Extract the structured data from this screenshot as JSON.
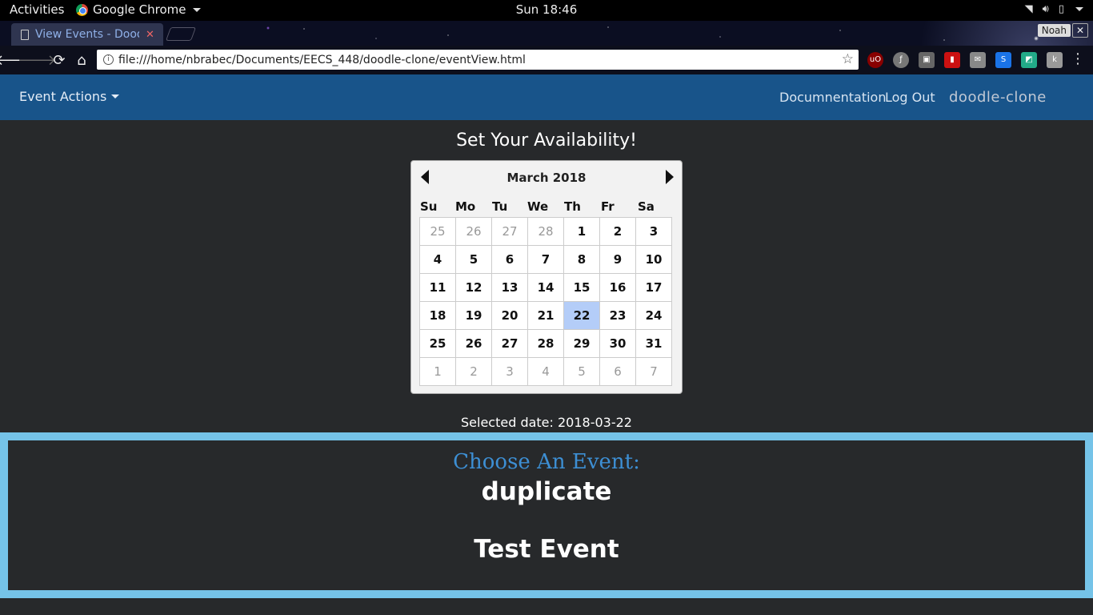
{
  "system": {
    "activities": "Activities",
    "app_name": "Google Chrome",
    "clock": "Sun 18:46"
  },
  "browser": {
    "tab_title": "View Events - Dood",
    "profile_name": "Noah",
    "url": "file:///home/nbrabec/Documents/EECS_448/doodle-clone/eventView.html"
  },
  "navbar": {
    "dropdown_label": "Event Actions",
    "documentation_label": "Documnentation",
    "logout_label": "Log Out",
    "brand_text": "doodle-clone"
  },
  "page": {
    "heading": "Set Your Availability!",
    "selected_date_text": "Selected date: 2018-03-22"
  },
  "calendar": {
    "month_label": "March 2018",
    "weekdays": [
      "Su",
      "Mo",
      "Tu",
      "We",
      "Th",
      "Fr",
      "Sa"
    ],
    "weeks": [
      [
        "25",
        "26",
        "27",
        "28",
        "1",
        "2",
        "3"
      ],
      [
        "4",
        "5",
        "6",
        "7",
        "8",
        "9",
        "10"
      ],
      [
        "11",
        "12",
        "13",
        "14",
        "15",
        "16",
        "17"
      ],
      [
        "18",
        "19",
        "20",
        "21",
        "22",
        "23",
        "24"
      ],
      [
        "25",
        "26",
        "27",
        "28",
        "29",
        "30",
        "31"
      ],
      [
        "1",
        "2",
        "3",
        "4",
        "5",
        "6",
        "7"
      ]
    ],
    "selected_day": "22"
  },
  "events": {
    "title": "Choose An Event:",
    "items": [
      "duplicate",
      "Test Event"
    ]
  },
  "colors": {
    "navbar": "#18548a",
    "page_bg": "#27292b",
    "events_border": "#75c3e8",
    "events_title": "#3d8fd4",
    "selected_day": "#b4cdf8"
  }
}
